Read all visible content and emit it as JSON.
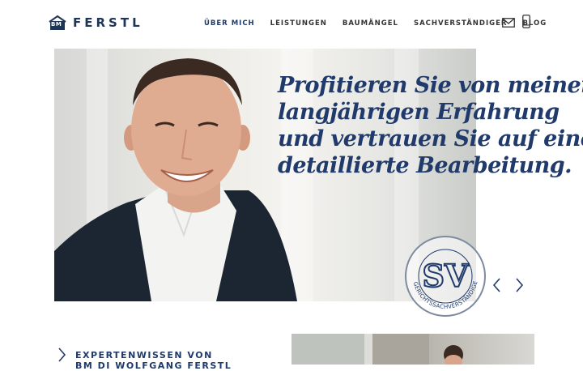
{
  "header": {
    "logo": {
      "monogram": "BM",
      "name": "FERSTL"
    },
    "nav": [
      {
        "label": "ÜBER MICH",
        "active": true
      },
      {
        "label": "LEISTUNGEN",
        "active": false
      },
      {
        "label": "BAUMÄNGEL",
        "active": false
      },
      {
        "label": "SACHVERSTÄNDIGER",
        "active": false
      },
      {
        "label": "BLOG",
        "active": false
      }
    ],
    "contact_icons": [
      "mail-icon",
      "mobile-phone-icon"
    ]
  },
  "hero": {
    "headline_lines": [
      "Profitieren Sie von meiner",
      "langjährigen Erfahrung",
      "und vertrauen Sie auf eine",
      "detaillierte Bearbeitung."
    ],
    "image": "portrait-of-smiling-man",
    "seal": {
      "letters": "SV",
      "ring_text": "GERICHTSSACHVERSTÄNDIGE"
    },
    "controls": [
      "chevron-left-icon",
      "chevron-right-icon"
    ]
  },
  "section": {
    "title_lines": [
      "EXPERTENWISSEN VON",
      "BM DI WOLFGANG FERSTL"
    ],
    "image": "portrait-photo"
  },
  "colors": {
    "brand": "#1f3a6b",
    "text": "#333333",
    "background": "#ffffff"
  }
}
